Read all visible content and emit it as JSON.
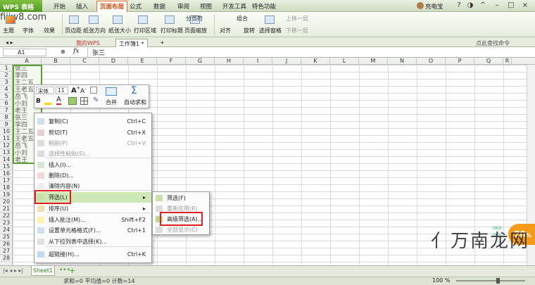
{
  "titlebar": {
    "app": "WPS 表格",
    "menus": [
      "开始",
      "插入",
      "页面布局",
      "公式",
      "数据",
      "审阅",
      "视图",
      "开发工具",
      "特色功能"
    ],
    "active_menu": "页面布局",
    "user": "充电宝"
  },
  "watermark_site": "fiiiw8.com",
  "ribbon": {
    "groups": [
      "主题",
      "字体",
      "效果",
      "页边距",
      "纸张方向",
      "纸张大小",
      "打印区域",
      "打印标题",
      "页面缩放",
      "分页符",
      "组合",
      "上移一层",
      "下移一层",
      "对齐",
      "旋转",
      "选择窗格"
    ]
  },
  "doctabs": {
    "mywps": "我的WPS",
    "book": "工作簿1 *",
    "search_hint": "点此查找命令 (Alt+Q)"
  },
  "formula": {
    "cellref": "A1",
    "fx": "fx",
    "value": "张三"
  },
  "columns": [
    "A",
    "B",
    "C",
    "D",
    "E",
    "F",
    "G",
    "H",
    "I",
    "J",
    "K",
    "L",
    "M",
    "N",
    "O",
    "P",
    "Q",
    "R"
  ],
  "rows": [
    "1",
    "2",
    "3",
    "4",
    "5",
    "6",
    "7",
    "8",
    "9",
    "10",
    "11",
    "12",
    "13",
    "14",
    "15",
    "16",
    "17",
    "18",
    "19",
    "20",
    "21",
    "22",
    "23",
    "24",
    "25",
    "26",
    "27",
    "28"
  ],
  "cells": [
    "张三",
    "李四",
    "王二五",
    "王老五",
    "岳飞",
    "小刘",
    "老王",
    "张三",
    "李四",
    "王二五",
    "王老五",
    "岳飞",
    "小刘",
    "老王"
  ],
  "mini_toolbar": {
    "font": "宋体",
    "size": "11",
    "merge": "合并",
    "autosum": "自动求和"
  },
  "context_menu": [
    {
      "label": "复制(C)",
      "shortcut": "Ctrl+C"
    },
    {
      "label": "剪切(T)",
      "shortcut": "Ctrl+X"
    },
    {
      "label": "粘贴(P)",
      "shortcut": "Ctrl+V"
    },
    {
      "label": "选择性粘贴(S)..."
    },
    {
      "label": "插入(I)..."
    },
    {
      "label": "删除(D)..."
    },
    {
      "label": "清除内容(N)"
    },
    {
      "label": "筛选(L)"
    },
    {
      "label": "排序(U)"
    },
    {
      "label": "插入批注(M)...",
      "shortcut": "Shift+F2"
    },
    {
      "label": "设置单元格格式(F)...",
      "shortcut": "Ctrl+1"
    },
    {
      "label": "从下拉列表中选择(K)..."
    },
    {
      "label": "超链接(H)...",
      "shortcut": "Ctrl+K"
    }
  ],
  "submenu": [
    {
      "label": "筛选(F)"
    },
    {
      "label": "重新应用(R)"
    },
    {
      "label": "高级筛选(A)..."
    },
    {
      "label": "全部显示(C)"
    }
  ],
  "sheet": {
    "name": "Sheet1"
  },
  "status": {
    "text": "求和=0 平均值=0 计数=14",
    "zoom": "100 %"
  },
  "speed": {
    "value": "70",
    "unit": "%",
    "up": "0K/s",
    "down": "0K/s"
  },
  "bottom_watermark": "亻万南龙网"
}
